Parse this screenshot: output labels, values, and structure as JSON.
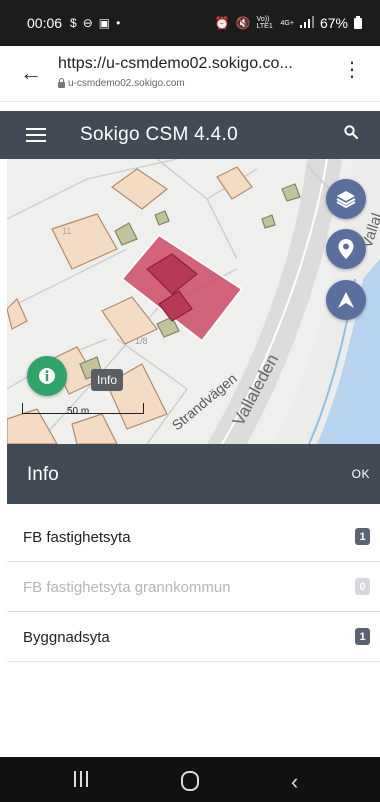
{
  "status_bar": {
    "time": "00:06",
    "left_icons": [
      "dollar-icon",
      "do-not-disturb-icon",
      "image-icon",
      "dot-icon"
    ],
    "right_icons": [
      "alarm-icon",
      "mute-icon",
      "volte-icon",
      "4g-icon",
      "signal-icon"
    ],
    "volte_text": "Vo)) LTE1",
    "network_text": "4G+",
    "battery_text": "67%"
  },
  "browser": {
    "url": "https://u-csmdemo02.sokigo.co...",
    "domain": "u-csmdemo02.sokigo.com"
  },
  "app_header": {
    "title": "Sokigo CSM 4.4.0"
  },
  "map": {
    "info_tooltip": "Info",
    "scale_label": "50 m",
    "street_labels": [
      "Strandvägen",
      "Vallaleden",
      "Vallal"
    ],
    "parcel_numbers": [
      "1/8",
      "11"
    ],
    "colors": {
      "selection_fill": "#cc4a66",
      "building_fill": "#f4dcc4",
      "building_stroke": "#b38a66",
      "green_building": "#c0c39c",
      "water": "#b6d4ef"
    }
  },
  "info_panel": {
    "title": "Info",
    "ok_label": "OK",
    "items": [
      {
        "label": "FB fastighetsyta",
        "count": "1",
        "enabled": true
      },
      {
        "label": "FB fastighetsyta grannkommun",
        "count": "0",
        "enabled": false
      },
      {
        "label": "Byggnadsyta",
        "count": "1",
        "enabled": true
      }
    ]
  },
  "colors": {
    "header_bg": "#424a56",
    "fab_blue": "#5a6f9e",
    "fab_green": "#2fa36a",
    "badge_bg": "#5b6370"
  }
}
